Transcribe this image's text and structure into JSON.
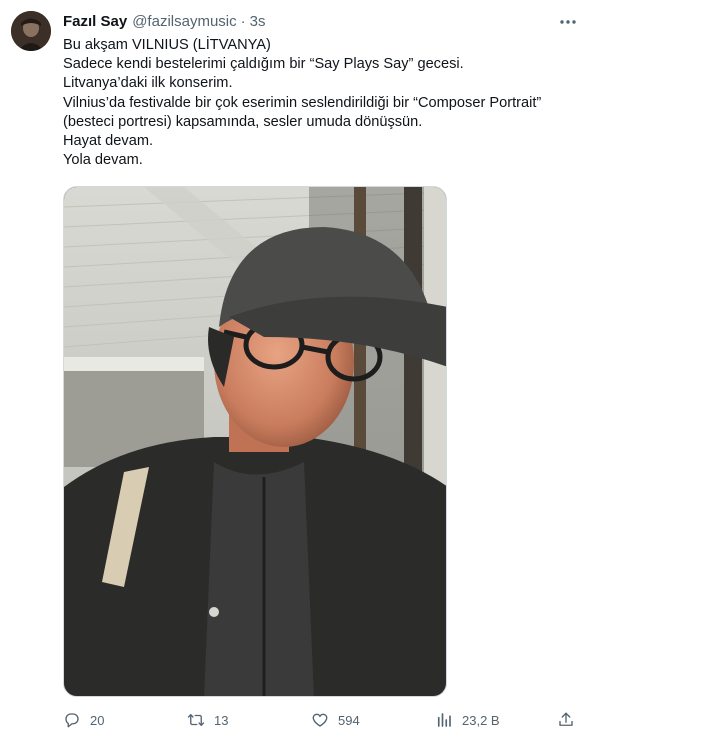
{
  "tweet": {
    "author": {
      "display_name": "Fazıl Say",
      "handle": "@fazilsaymusic",
      "time": "3s",
      "separator": "·"
    },
    "text_lines": [
      "Bu akşam VILNIUS (LİTVANYA)",
      "Sadece kendi bestelerimi çaldığım bir “Say Plays Say” gecesi.",
      "Litvanya’daki ilk konserim.",
      "Vilnius’da festivalde bir çok eserimin seslendirildiği bir “Composer Portrait”",
      "(besteci portresi) kapsamında, sesler umuda dönüşsün.",
      "Hayat devam.",
      "Yola devam."
    ],
    "actions": {
      "reply": {
        "icon": "reply-icon",
        "count": "20"
      },
      "retweet": {
        "icon": "retweet-icon",
        "count": "13"
      },
      "like": {
        "icon": "heart-icon",
        "count": "594"
      },
      "views": {
        "icon": "views-icon",
        "count": "23,2 B"
      },
      "share": {
        "icon": "share-icon"
      }
    }
  },
  "colors": {
    "text_primary": "#0f1419",
    "text_secondary": "#536471",
    "border": "#cfd9de"
  }
}
